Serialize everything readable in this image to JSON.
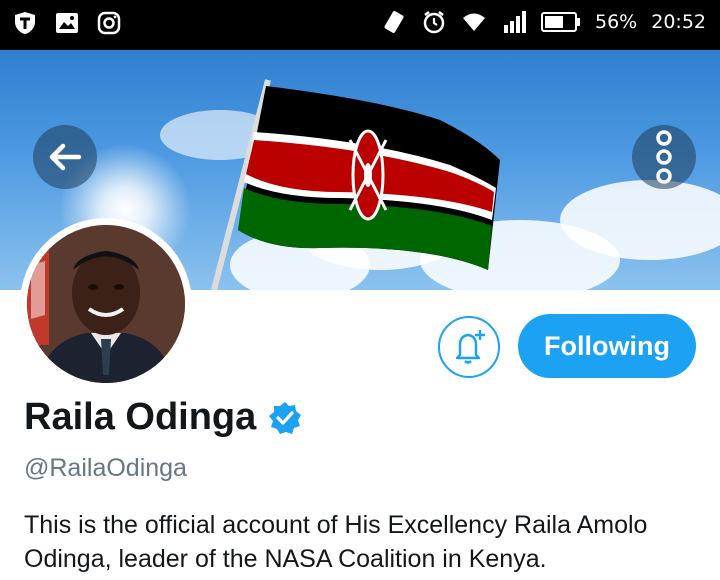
{
  "status_bar": {
    "battery": "56%",
    "time": "20:52"
  },
  "profile": {
    "name": "Raila Odinga",
    "handle": "@RailaOdinga",
    "bio": "This is the official account of His Excellency Raila Amolo Odinga, leader of the NASA Coalition in Kenya.",
    "following_label": "Following"
  },
  "colors": {
    "accent": "#1da1f2",
    "verified": "#1da1f2"
  },
  "icons": {
    "back": "arrow-left-icon",
    "more": "more-vertical-icon",
    "notify": "bell-plus-icon",
    "verified": "verified-badge-icon"
  }
}
